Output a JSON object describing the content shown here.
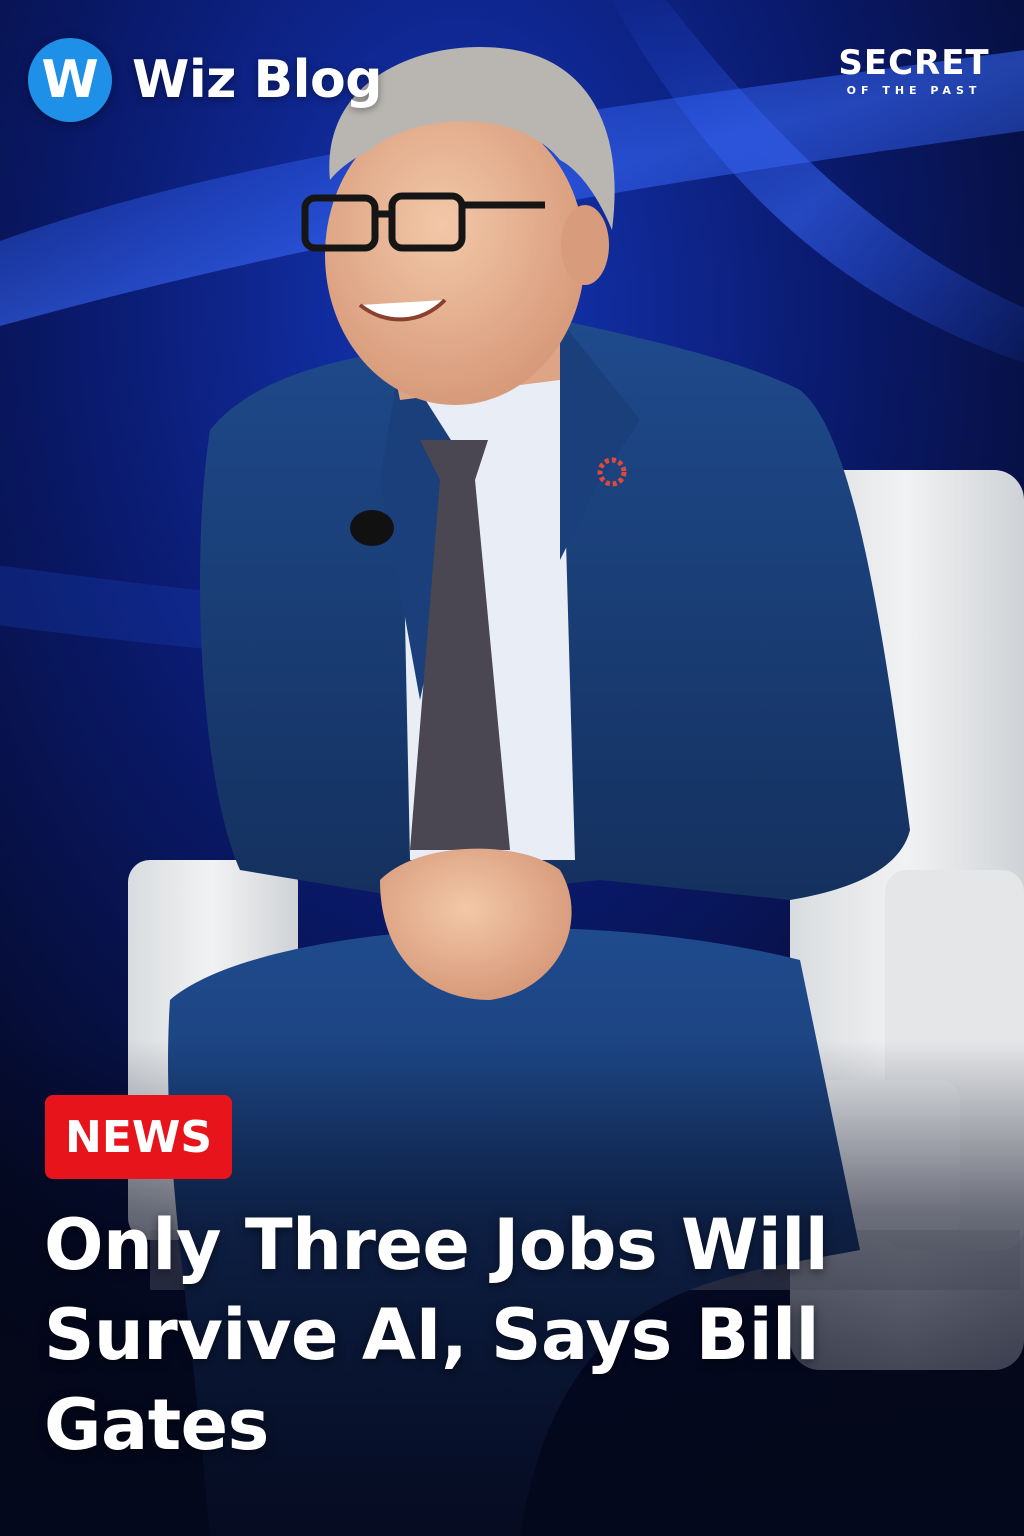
{
  "brand": {
    "logo_letter": "W",
    "name": "Wiz Blog",
    "logo_color": "#1e90e8"
  },
  "partner": {
    "name": "SECRET",
    "tagline": "OF THE PAST"
  },
  "badge": {
    "label": "NEWS",
    "color": "#e8141b"
  },
  "headline": "Only Three Jobs Will Survive AI, Says Bill Gates",
  "photo": {
    "subject": "man-in-blue-suit-seated-in-white-armchair",
    "background_color": "#0a1a6e"
  }
}
